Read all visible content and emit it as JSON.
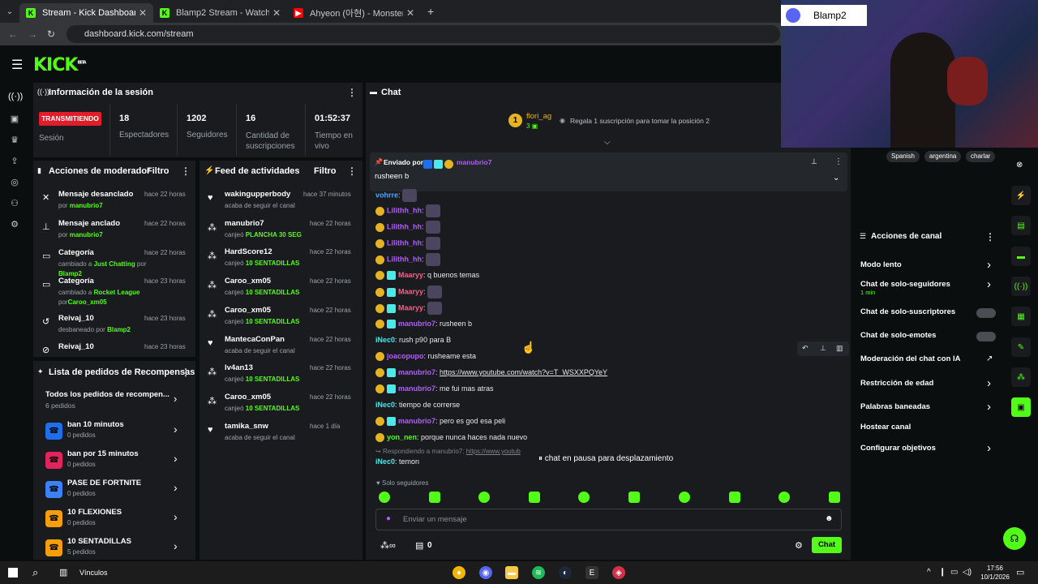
{
  "browser": {
    "tabs": [
      {
        "title": "Stream - Kick Dashboard",
        "icon": "kick-icon"
      },
      {
        "title": "Blamp2 Stream - Watch Live on",
        "icon": "kick-icon"
      },
      {
        "title": "Ahyeon (아현) - Monster | Begi",
        "icon": "youtube-icon"
      }
    ],
    "url": "dashboard.kick.com/stream"
  },
  "app": {
    "logo": "KICK",
    "logo_sup": "BETA",
    "accent": "#53fc18"
  },
  "session": {
    "title": "Información de la sesión",
    "live_badge": "TRANSMITIENDO",
    "session_label": "Sesión",
    "stats": [
      {
        "value": "18",
        "label": "Espectadores"
      },
      {
        "value": "1202",
        "label": "Seguidores"
      },
      {
        "value": "16",
        "label": "Cantidad de suscripciones"
      },
      {
        "value": "01:52:37",
        "label": "Tiempo en vivo"
      }
    ]
  },
  "mod_actions": {
    "title": "Acciones de moderador",
    "filter": "Filtro",
    "items": [
      {
        "title": "Mensaje desanclado",
        "pre": "por ",
        "hl": "manubrio7",
        "mid": "",
        "hl2": "",
        "time": "hace 22 horas"
      },
      {
        "title": "Mensaje anclado",
        "pre": "por ",
        "hl": "manubrio7",
        "mid": "",
        "hl2": "",
        "time": "hace 22 horas"
      },
      {
        "title": "Categoría",
        "pre": "cambiado a ",
        "hl": "Just Chatting",
        "mid": " por ",
        "hl2": "Blamp2",
        "time": "hace 22 horas"
      },
      {
        "title": "Categoría",
        "pre": "cambiado a ",
        "hl": "Rocket League",
        "mid": " por",
        "hl2": "Caroo_xm05",
        "time": "hace 23 horas"
      },
      {
        "title": "Reivaj_10",
        "pre": "desbaneado por ",
        "hl": "Blamp2",
        "mid": "",
        "hl2": "",
        "time": "hace 23 horas"
      },
      {
        "title": "Reivaj_10",
        "pre": "",
        "hl": "",
        "mid": "",
        "hl2": "",
        "time": "hace 23 horas"
      }
    ]
  },
  "activity": {
    "title": "Feed de actividades",
    "filter": "Filtro",
    "items": [
      {
        "user": "wakingupperbody",
        "pre": "acaba de seguir el canal",
        "hl": "",
        "time": "hace 37 minutos",
        "icon": "heart-icon"
      },
      {
        "user": "manubrio7",
        "pre": "canjeó ",
        "hl": "PLANCHA 30 SEG",
        "time": "hace 22 horas",
        "icon": "points-icon"
      },
      {
        "user": "HardScore12",
        "pre": "canjeó ",
        "hl": "10 SENTADILLAS",
        "time": "hace 22 horas",
        "icon": "points-icon"
      },
      {
        "user": "Caroo_xm05",
        "pre": "canjeó ",
        "hl": "10 SENTADILLAS",
        "time": "hace 22 horas",
        "icon": "points-icon"
      },
      {
        "user": "Caroo_xm05",
        "pre": "canjeó ",
        "hl": "10 SENTADILLAS",
        "time": "hace 22 horas",
        "icon": "points-icon"
      },
      {
        "user": "MantecaConPan",
        "pre": "acaba de seguir el canal",
        "hl": "",
        "time": "hace 22 horas",
        "icon": "heart-icon"
      },
      {
        "user": "lv4an13",
        "pre": "canjeó ",
        "hl": "10 SENTADILLAS",
        "time": "hace 22 horas",
        "icon": "points-icon"
      },
      {
        "user": "Caroo_xm05",
        "pre": "canjeó ",
        "hl": "10 SENTADILLAS",
        "time": "hace 22 horas",
        "icon": "points-icon"
      },
      {
        "user": "tamika_snw",
        "pre": "acaba de seguir el canal",
        "hl": "",
        "time": "hace 1 día",
        "icon": "heart-icon"
      }
    ]
  },
  "rewards": {
    "title": "Lista de pedidos de Recompensas",
    "all_title": "Todos los pedidos de recompen...",
    "all_count": "6 pedidos",
    "items": [
      {
        "name": "ban 10 minutos",
        "count": "0 pedidos",
        "color": "#1f6feb"
      },
      {
        "name": "ban por 15 minutos",
        "count": "0 pedidos",
        "color": "#e0245e"
      },
      {
        "name": "PASE DE FORTNITE",
        "count": "0 pedidos",
        "color": "#3b82f6"
      },
      {
        "name": "10 FLEXIONES",
        "count": "0 pedidos",
        "color": "#f59e0b"
      },
      {
        "name": "10 SENTADILLAS",
        "count": "5 pedidos",
        "color": "#f59e0b"
      }
    ]
  },
  "chat": {
    "title": "Chat",
    "top_gifter": {
      "name": "flori_ag",
      "count": "3",
      "rank": "1",
      "gift_text": "Regala 1 suscripción para tomar la posición 2"
    },
    "pinned": {
      "sent_by": "Enviado por",
      "user": "manubrio7",
      "text": "rusheen b"
    },
    "messages": [
      {
        "user": "vohrre",
        "text": "",
        "color": "#4da6ff"
      },
      {
        "user": "Lilithh_hh",
        "text": "",
        "color": "#b35cff"
      },
      {
        "user": "Lilithh_hh",
        "text": "",
        "color": "#b35cff"
      },
      {
        "user": "Lilithh_hh",
        "text": "",
        "color": "#b35cff"
      },
      {
        "user": "Lilithh_hh",
        "text": "",
        "color": "#b35cff"
      },
      {
        "user": "Maaryy",
        "text": "q buenos temas",
        "color": "#ff5c8a"
      },
      {
        "user": "Maaryy",
        "text": "",
        "color": "#ff5c8a"
      },
      {
        "user": "Maaryy",
        "text": "",
        "color": "#ff5c8a"
      },
      {
        "user": "manubrio7",
        "text": "rusheen b",
        "color": "#b35cff"
      },
      {
        "user": "iNec0",
        "text": "rush p90 para B",
        "color": "#4de8e8"
      },
      {
        "user": "joacopupo",
        "text": "rusheame esta",
        "color": "#b35cff"
      },
      {
        "user": "manubrio7",
        "text": "https://www.youtube.com/watch?v=T_WSXXPQYeY",
        "color": "#b35cff"
      },
      {
        "user": "manubrio7",
        "text": "me fui mas atras",
        "color": "#b35cff"
      },
      {
        "user": "iNec0",
        "text": "tiempo de correrse",
        "color": "#4de8e8"
      },
      {
        "user": "manubrio7",
        "text": "pero es god esa peli",
        "color": "#b35cff"
      },
      {
        "user": "yon_nen",
        "text": "porque nunca haces nada nuevo",
        "color": "#53fc18"
      }
    ],
    "reply_hint": "Respondiendo a manubrio7:",
    "reply_link": "https://www.youtub",
    "last": {
      "user": "iNec0",
      "text": "temon"
    },
    "paused": "chat en pausa para desplazamiento",
    "followers_only": "Solo seguidores",
    "input_placeholder": "Enviar un mensaje",
    "points": "0",
    "send": "Chat"
  },
  "stream_tags": [
    "Spanish",
    "argentina",
    "charlar"
  ],
  "channel_actions": {
    "title": "Acciones de canal",
    "items": [
      {
        "label": "Modo lento",
        "sub": "",
        "control": "chevron"
      },
      {
        "label": "Chat de solo-seguidores",
        "sub": "1 min",
        "control": "chevron"
      },
      {
        "label": "Chat de solo-suscriptores",
        "sub": "",
        "control": "toggle"
      },
      {
        "label": "Chat de solo-emotes",
        "sub": "",
        "control": "toggle"
      },
      {
        "label": "Moderación del chat con IA",
        "sub": "",
        "control": "external"
      },
      {
        "label": "Restricción de edad",
        "sub": "",
        "control": "chevron"
      },
      {
        "label": "Palabras baneadas",
        "sub": "",
        "control": "chevron"
      },
      {
        "label": "Hostear canal",
        "sub": "",
        "control": ""
      },
      {
        "label": "Configurar objetivos",
        "sub": "",
        "control": "chevron"
      }
    ]
  },
  "webcam": {
    "name": "Blamp2"
  },
  "taskbar": {
    "links": "Vínculos",
    "time": "17:56",
    "date": "10/1/2026"
  }
}
